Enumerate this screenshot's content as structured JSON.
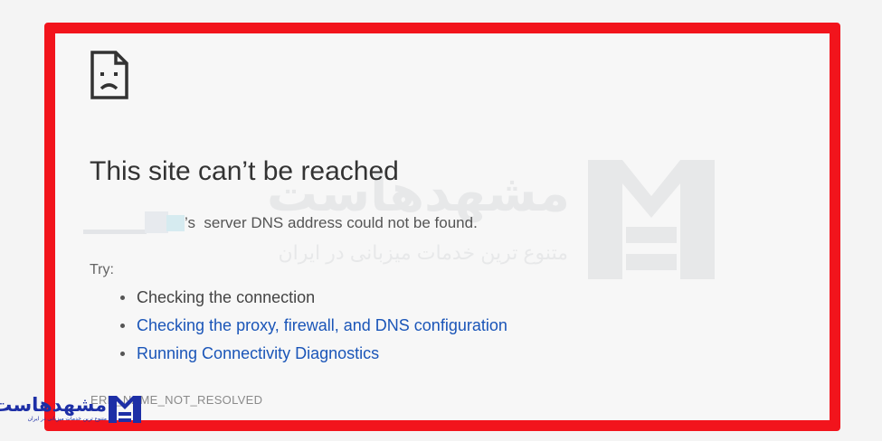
{
  "error_page": {
    "title": "This site can’t be reached",
    "message": "’s  server DNS address could not be found.",
    "try_label": "Try:",
    "suggestions": [
      {
        "label": "Checking the connection",
        "is_link": false
      },
      {
        "label": "Checking the proxy, firewall, and DNS configuration",
        "is_link": true
      },
      {
        "label": "Running Connectivity Diagnostics",
        "is_link": true
      }
    ],
    "error_code": "ERR_NAME_NOT_RESOLVED",
    "sad_icon": "sad-page-icon"
  },
  "watermark": {
    "brand": "مشهدهاست",
    "tagline": "متنوع ترین خدمات میزبانی در ایران"
  },
  "corner_logo": {
    "brand": "مشهدهاست",
    "tagline": "متنوع ترین خدمات میزبانی در ایران",
    "color": "#1d2fa6"
  },
  "colors": {
    "frame": "#f2141c",
    "link": "#1a55b8",
    "title": "#333333"
  }
}
